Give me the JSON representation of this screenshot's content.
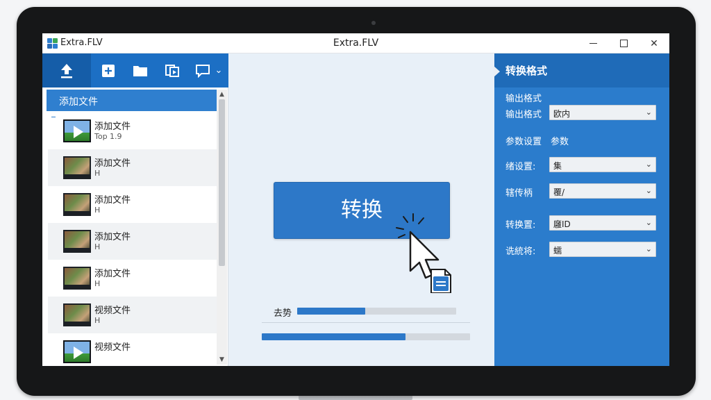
{
  "window": {
    "app_name": "Extra.FLV",
    "title": "Extra.FLV",
    "minimize_icon": "minimize-icon",
    "maximize_icon": "maximize-icon",
    "close_glyph": "✕"
  },
  "toolbar": {
    "items": [
      "upload-icon",
      "add-icon",
      "folder-icon",
      "copy-icon",
      "comment-icon"
    ],
    "dropdown_glyph": "⌄"
  },
  "file_list": {
    "header": "添加文件",
    "items": [
      {
        "name": "添加文件",
        "sub": "Top 1.9",
        "thumb": "video"
      },
      {
        "name": "添加文件",
        "sub": "H",
        "thumb": "people"
      },
      {
        "name": "添加文件",
        "sub": "H",
        "thumb": "people"
      },
      {
        "name": "添加文件",
        "sub": "H",
        "thumb": "people"
      },
      {
        "name": "添加文件",
        "sub": "H",
        "thumb": "people"
      },
      {
        "name": "视频文件",
        "sub": "H",
        "thumb": "people"
      },
      {
        "name": "视频文件",
        "sub": "",
        "thumb": "video"
      }
    ]
  },
  "center": {
    "convert_label": "转换",
    "progress_label": "去势",
    "progress_1": 0.43,
    "progress_2": 0.69
  },
  "settings": {
    "title": "转换格式",
    "output_section": "输出格式",
    "output_format_label": "输出格式",
    "output_format_value": "欧内",
    "params_label": "参数设置",
    "params_value": "参数",
    "row1_label": "绪设置:",
    "row1_value": "集",
    "row2_label": "辖传柄",
    "row2_value": "覆/",
    "row3_label": "转换置:",
    "row3_value": "廱ID",
    "row4_label": "诜統将:",
    "row4_value": "蠕"
  },
  "colors": {
    "accent": "#2d78c8",
    "panel": "#2b7ccc",
    "toolbar": "#1c6fc4"
  }
}
